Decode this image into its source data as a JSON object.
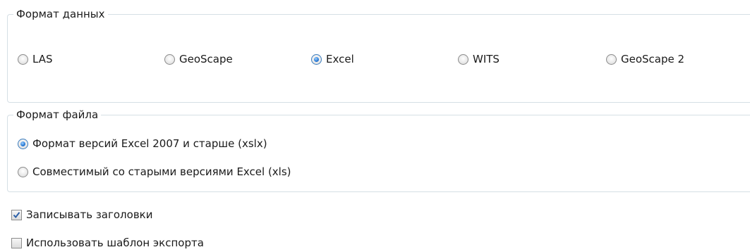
{
  "data_format": {
    "title": "Формат данных",
    "options": [
      {
        "label": "LAS",
        "checked": false
      },
      {
        "label": "GeoScape",
        "checked": false
      },
      {
        "label": "Excel",
        "checked": true
      },
      {
        "label": "WITS",
        "checked": false
      },
      {
        "label": "GeoScape 2",
        "checked": false
      }
    ]
  },
  "file_format": {
    "title": "Формат файла",
    "options": [
      {
        "label": "Формат версий Excel 2007 и старше (xslx)",
        "checked": true
      },
      {
        "label": "Совместимый со старыми версиями Excel (xls)",
        "checked": false
      }
    ]
  },
  "write_headers": {
    "label": "Записывать заголовки",
    "checked": true
  },
  "use_export_template": {
    "label": "Использовать шаблон экспорта",
    "checked": false
  },
  "colors": {
    "accent": "#2f7fd8",
    "check_mark": "#2b5fa8",
    "border": "#d5dfe5"
  }
}
